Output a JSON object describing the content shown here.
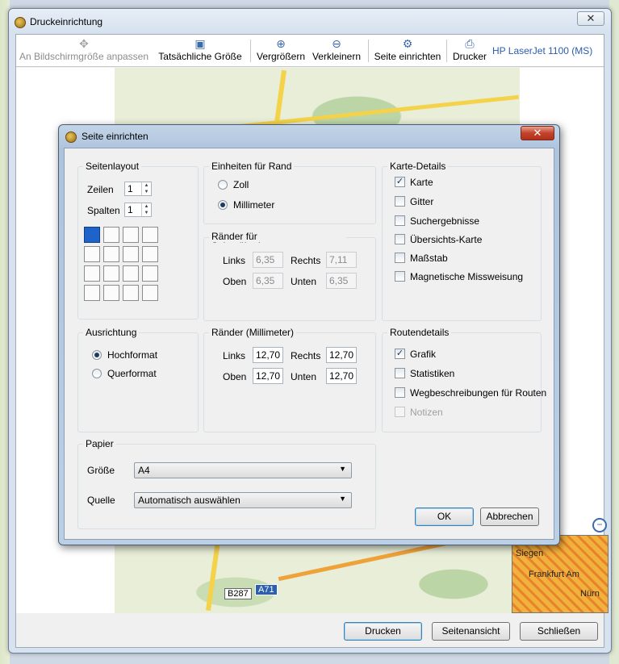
{
  "main_window": {
    "title": "Druckeinrichtung",
    "close_glyph": "✕",
    "toolbar": {
      "fit": "An Bildschirmgröße anpassen",
      "actual": "Tatsächliche Größe",
      "zoom_in": "Vergrößern",
      "zoom_out": "Verkleinern",
      "page_setup": "Seite einrichten",
      "printer": "Drucker",
      "printer_name": "HP LaserJet 1100 (MS)"
    },
    "map_labels": {
      "road_a": "A71",
      "road_b": "B287",
      "mini_1": "Siegen",
      "mini_2": "Frankfurt Am",
      "mini_3": "Nürn"
    },
    "footer": {
      "print": "Drucken",
      "preview": "Seitenansicht",
      "close": "Schließen"
    }
  },
  "dialog": {
    "title": "Seite einrichten",
    "close_glyph": "✕",
    "page_layout": {
      "legend": "Seitenlayout",
      "rows_label": "Zeilen",
      "rows_value": "1",
      "cols_label": "Spalten",
      "cols_value": "1"
    },
    "units": {
      "legend": "Einheiten für Rand",
      "inch": "Zoll",
      "mm": "Millimeter",
      "selected": "mm"
    },
    "overlap": {
      "legend": "Ränder für Seitenüberlagerung (Millimeter)",
      "left_label": "Links",
      "left": "6,35",
      "right_label": "Rechts",
      "right": "7,11",
      "top_label": "Oben",
      "top": "6,35",
      "bottom_label": "Unten",
      "bottom": "6,35"
    },
    "map_details": {
      "legend": "Karte-Details",
      "items": [
        {
          "label": "Karte",
          "checked": true
        },
        {
          "label": "Gitter",
          "checked": false
        },
        {
          "label": "Suchergebnisse",
          "checked": false
        },
        {
          "label": "Übersichts-Karte",
          "checked": false
        },
        {
          "label": "Maßstab",
          "checked": false
        },
        {
          "label": "Magnetische Missweisung",
          "checked": false
        }
      ]
    },
    "orientation": {
      "legend": "Ausrichtung",
      "portrait": "Hochformat",
      "landscape": "Querformat",
      "selected": "portrait"
    },
    "margins": {
      "legend": "Ränder (Millimeter)",
      "left_label": "Links",
      "left": "12,70",
      "right_label": "Rechts",
      "right": "12,70",
      "top_label": "Oben",
      "top": "12,70",
      "bottom_label": "Unten",
      "bottom": "12,70"
    },
    "route_details": {
      "legend": "Routendetails",
      "items": [
        {
          "label": "Grafik",
          "checked": true,
          "enabled": true
        },
        {
          "label": "Statistiken",
          "checked": false,
          "enabled": true
        },
        {
          "label": "Wegbeschreibungen für Routen",
          "checked": false,
          "enabled": true
        },
        {
          "label": "Notizen",
          "checked": false,
          "enabled": false
        }
      ]
    },
    "paper": {
      "legend": "Papier",
      "size_label": "Größe",
      "size_value": "A4",
      "source_label": "Quelle",
      "source_value": "Automatisch auswählen"
    },
    "buttons": {
      "ok": "OK",
      "cancel": "Abbrechen"
    }
  }
}
